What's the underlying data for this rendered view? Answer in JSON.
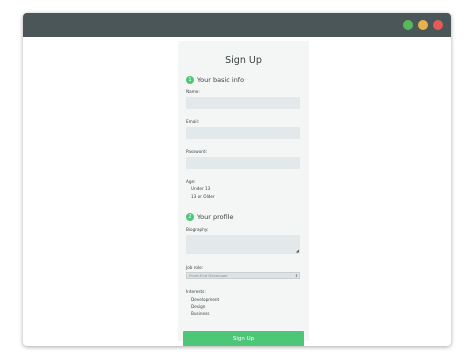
{
  "colors": {
    "titlebar": "#4a5658",
    "dot_green": "#55b95a",
    "dot_yellow": "#e6b24a",
    "dot_red": "#e25b57",
    "accent": "#4ec677"
  },
  "form": {
    "title": "Sign Up",
    "section1": {
      "number": "1",
      "label": "Your basic info"
    },
    "name_label": "Name:",
    "email_label": "Email:",
    "password_label": "Password:",
    "age_label": "Age:",
    "age_options": [
      "Under 13",
      "13 or Older"
    ],
    "section2": {
      "number": "2",
      "label": "Your profile"
    },
    "bio_label": "Biography:",
    "job_label": "Job role:",
    "job_value": "Front-End Developer",
    "interests_label": "Interests:",
    "interests": [
      "Development",
      "Design",
      "Business"
    ],
    "submit_label": "Sign Up"
  }
}
